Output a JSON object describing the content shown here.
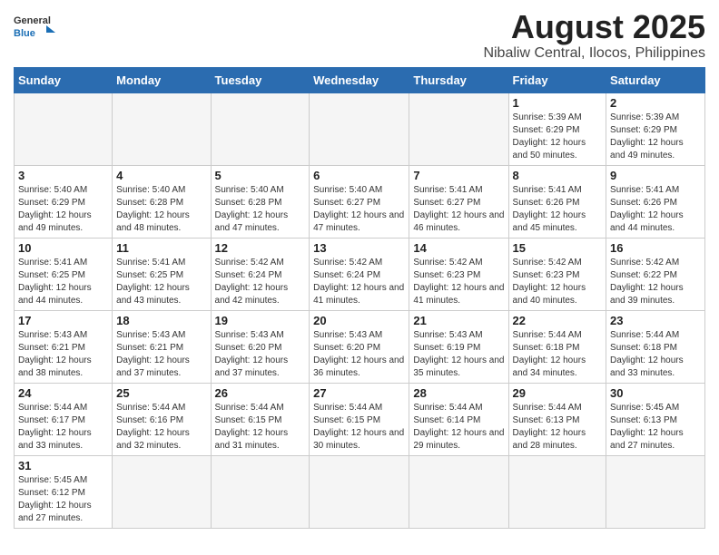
{
  "header": {
    "logo_general": "General",
    "logo_blue": "Blue",
    "title": "August 2025",
    "subtitle": "Nibaliw Central, Ilocos, Philippines"
  },
  "weekdays": [
    "Sunday",
    "Monday",
    "Tuesday",
    "Wednesday",
    "Thursday",
    "Friday",
    "Saturday"
  ],
  "weeks": [
    [
      {
        "day": "",
        "info": ""
      },
      {
        "day": "",
        "info": ""
      },
      {
        "day": "",
        "info": ""
      },
      {
        "day": "",
        "info": ""
      },
      {
        "day": "",
        "info": ""
      },
      {
        "day": "1",
        "info": "Sunrise: 5:39 AM\nSunset: 6:29 PM\nDaylight: 12 hours\nand 50 minutes."
      },
      {
        "day": "2",
        "info": "Sunrise: 5:39 AM\nSunset: 6:29 PM\nDaylight: 12 hours\nand 49 minutes."
      }
    ],
    [
      {
        "day": "3",
        "info": "Sunrise: 5:40 AM\nSunset: 6:29 PM\nDaylight: 12 hours\nand 49 minutes."
      },
      {
        "day": "4",
        "info": "Sunrise: 5:40 AM\nSunset: 6:28 PM\nDaylight: 12 hours\nand 48 minutes."
      },
      {
        "day": "5",
        "info": "Sunrise: 5:40 AM\nSunset: 6:28 PM\nDaylight: 12 hours\nand 47 minutes."
      },
      {
        "day": "6",
        "info": "Sunrise: 5:40 AM\nSunset: 6:27 PM\nDaylight: 12 hours\nand 47 minutes."
      },
      {
        "day": "7",
        "info": "Sunrise: 5:41 AM\nSunset: 6:27 PM\nDaylight: 12 hours\nand 46 minutes."
      },
      {
        "day": "8",
        "info": "Sunrise: 5:41 AM\nSunset: 6:26 PM\nDaylight: 12 hours\nand 45 minutes."
      },
      {
        "day": "9",
        "info": "Sunrise: 5:41 AM\nSunset: 6:26 PM\nDaylight: 12 hours\nand 44 minutes."
      }
    ],
    [
      {
        "day": "10",
        "info": "Sunrise: 5:41 AM\nSunset: 6:25 PM\nDaylight: 12 hours\nand 44 minutes."
      },
      {
        "day": "11",
        "info": "Sunrise: 5:41 AM\nSunset: 6:25 PM\nDaylight: 12 hours\nand 43 minutes."
      },
      {
        "day": "12",
        "info": "Sunrise: 5:42 AM\nSunset: 6:24 PM\nDaylight: 12 hours\nand 42 minutes."
      },
      {
        "day": "13",
        "info": "Sunrise: 5:42 AM\nSunset: 6:24 PM\nDaylight: 12 hours\nand 41 minutes."
      },
      {
        "day": "14",
        "info": "Sunrise: 5:42 AM\nSunset: 6:23 PM\nDaylight: 12 hours\nand 41 minutes."
      },
      {
        "day": "15",
        "info": "Sunrise: 5:42 AM\nSunset: 6:23 PM\nDaylight: 12 hours\nand 40 minutes."
      },
      {
        "day": "16",
        "info": "Sunrise: 5:42 AM\nSunset: 6:22 PM\nDaylight: 12 hours\nand 39 minutes."
      }
    ],
    [
      {
        "day": "17",
        "info": "Sunrise: 5:43 AM\nSunset: 6:21 PM\nDaylight: 12 hours\nand 38 minutes."
      },
      {
        "day": "18",
        "info": "Sunrise: 5:43 AM\nSunset: 6:21 PM\nDaylight: 12 hours\nand 37 minutes."
      },
      {
        "day": "19",
        "info": "Sunrise: 5:43 AM\nSunset: 6:20 PM\nDaylight: 12 hours\nand 37 minutes."
      },
      {
        "day": "20",
        "info": "Sunrise: 5:43 AM\nSunset: 6:20 PM\nDaylight: 12 hours\nand 36 minutes."
      },
      {
        "day": "21",
        "info": "Sunrise: 5:43 AM\nSunset: 6:19 PM\nDaylight: 12 hours\nand 35 minutes."
      },
      {
        "day": "22",
        "info": "Sunrise: 5:44 AM\nSunset: 6:18 PM\nDaylight: 12 hours\nand 34 minutes."
      },
      {
        "day": "23",
        "info": "Sunrise: 5:44 AM\nSunset: 6:18 PM\nDaylight: 12 hours\nand 33 minutes."
      }
    ],
    [
      {
        "day": "24",
        "info": "Sunrise: 5:44 AM\nSunset: 6:17 PM\nDaylight: 12 hours\nand 33 minutes."
      },
      {
        "day": "25",
        "info": "Sunrise: 5:44 AM\nSunset: 6:16 PM\nDaylight: 12 hours\nand 32 minutes."
      },
      {
        "day": "26",
        "info": "Sunrise: 5:44 AM\nSunset: 6:15 PM\nDaylight: 12 hours\nand 31 minutes."
      },
      {
        "day": "27",
        "info": "Sunrise: 5:44 AM\nSunset: 6:15 PM\nDaylight: 12 hours\nand 30 minutes."
      },
      {
        "day": "28",
        "info": "Sunrise: 5:44 AM\nSunset: 6:14 PM\nDaylight: 12 hours\nand 29 minutes."
      },
      {
        "day": "29",
        "info": "Sunrise: 5:44 AM\nSunset: 6:13 PM\nDaylight: 12 hours\nand 28 minutes."
      },
      {
        "day": "30",
        "info": "Sunrise: 5:45 AM\nSunset: 6:13 PM\nDaylight: 12 hours\nand 27 minutes."
      }
    ],
    [
      {
        "day": "31",
        "info": "Sunrise: 5:45 AM\nSunset: 6:12 PM\nDaylight: 12 hours\nand 27 minutes."
      },
      {
        "day": "",
        "info": ""
      },
      {
        "day": "",
        "info": ""
      },
      {
        "day": "",
        "info": ""
      },
      {
        "day": "",
        "info": ""
      },
      {
        "day": "",
        "info": ""
      },
      {
        "day": "",
        "info": ""
      }
    ]
  ]
}
